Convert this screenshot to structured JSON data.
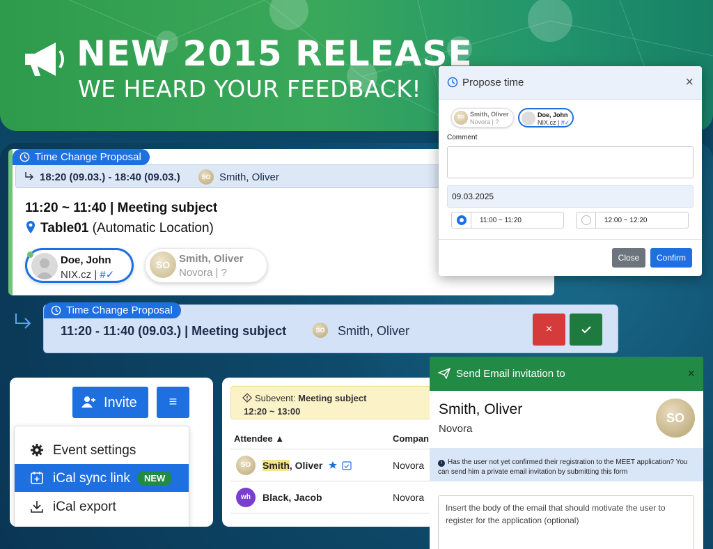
{
  "banner": {
    "title": "NEW 2015 RELEASE",
    "subtitle": "WE HEARD YOUR FEEDBACK!"
  },
  "proposal_card": {
    "badge": "Time Change Proposal",
    "range": "18:20 (09.03.) - 18:40 (09.03.)",
    "avatar": "SO",
    "person": "Smith, Oliver",
    "subject_time": "11:20 ~ 11:40",
    "subject_sep": " | ",
    "subject": "Meeting subject",
    "location_name": "Table01",
    "location_note": "(Automatic Location)",
    "attendees": [
      {
        "name": "Doe, John",
        "company": "NIX.cz",
        "status": "#✓"
      },
      {
        "name": "Smith, Oliver",
        "initials": "SO",
        "company": "Novora",
        "status": "?"
      }
    ],
    "sep": " | "
  },
  "proposal_bar": {
    "badge": "Time Change Proposal",
    "text": "11:20 - 11:40 (09.03.) | Meeting subject",
    "avatar": "SO",
    "person": "Smith, Oliver",
    "reject": "×"
  },
  "propose_modal": {
    "title": "Propose time",
    "close_x": "×",
    "attendees": [
      {
        "name": "Smith, Oliver",
        "initials": "SO",
        "company": "Novora",
        "status": "?"
      },
      {
        "name": "Doe, John",
        "company": "NIX.cz",
        "status": "#✓"
      }
    ],
    "sep": " | ",
    "comment_label": "Comment",
    "date": "09.03.2025",
    "slots": [
      "11:00 ~ 11:20",
      "12:00 ~ 12:20"
    ],
    "close_btn": "Close",
    "confirm_btn": "Confirm"
  },
  "invite_panel": {
    "invite_btn": "Invite",
    "menu_btn": "≡",
    "menu": [
      {
        "label": "Event settings"
      },
      {
        "label": "iCal sync link",
        "badge": "NEW"
      },
      {
        "label": "iCal export"
      }
    ]
  },
  "subevent": {
    "label": "Subevent:",
    "title": "Meeting subject",
    "time": "12:20 ~ 13:00",
    "col_attendee": "Attendee ▲",
    "col_company": "Compan",
    "rows": [
      {
        "initials": "SO",
        "first": "Smith",
        "rest": ", Oliver",
        "company": "Novora"
      },
      {
        "initials": "wh",
        "name": "Black, Jacob",
        "company": "Novora"
      }
    ]
  },
  "email_panel": {
    "title": "Send Email invitation to",
    "close_x": "×",
    "name": "Smith, Oliver",
    "company": "Novora",
    "initials": "SO",
    "info": "Has the user not yet confirmed their registration to the MEET application? You can send him a private email invitation by submitting this form",
    "body_placeholder": "Insert the body of the email that should motivate the user to register for the application (optional)"
  },
  "colors": {
    "primary": "#1e6fe0",
    "success": "#218a44",
    "danger": "#d63b3b",
    "banner_green": "#3aa85a"
  }
}
